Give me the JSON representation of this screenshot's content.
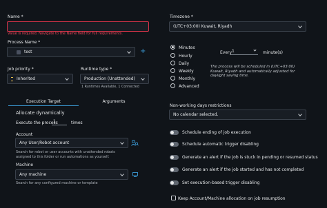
{
  "left": {
    "name": {
      "label": "Name *",
      "value": "",
      "error": "Value is required. Navigate to the Name field for full requirements."
    },
    "process": {
      "label": "Process Name *",
      "value": "test",
      "add_icon": "plus-icon"
    },
    "job_priority": {
      "label": "Job priority *",
      "value": "Inherited"
    },
    "runtime_type": {
      "label": "Runtime type *",
      "value": "Production (Unattended)",
      "info": "1 Runtimes Available, 1 Connected"
    },
    "tabs": [
      {
        "label": "Execution Target",
        "active": true
      },
      {
        "label": "Arguments",
        "active": false
      }
    ],
    "allocate_title": "Allocate dynamically",
    "execute_prefix": "Execute the process",
    "execute_value": "1",
    "execute_suffix": "times",
    "account": {
      "label": "Account",
      "value": "Any User/Robot account",
      "help": "Search for robot or user accounts with unattended robots assigned to this folder or run automations as yourself."
    },
    "machine": {
      "label": "Machine",
      "value": "Any machine",
      "help": "Search for any configured machine or template"
    }
  },
  "right": {
    "timezone": {
      "label": "Timezone *",
      "value": "(UTC+03:00) Kuwait, Riyadh"
    },
    "frequency_options": [
      {
        "label": "Minutes",
        "selected": true
      },
      {
        "label": "Hourly",
        "selected": false
      },
      {
        "label": "Daily",
        "selected": false
      },
      {
        "label": "Weekly",
        "selected": false
      },
      {
        "label": "Monthly",
        "selected": false
      },
      {
        "label": "Advanced",
        "selected": false
      }
    ],
    "every_prefix": "Every",
    "every_value": "1",
    "every_suffix": "minute(s)",
    "schedule_note": "The process will be scheduled in (UTC+03:00) Kuwait, Riyadh and automatically adjusted for daylight saving time.",
    "non_working": {
      "label": "Non-working days restrictions",
      "value": "No calendar selected."
    },
    "toggles": [
      {
        "label": "Schedule ending of job execution"
      },
      {
        "label": "Schedule automatic trigger disabling"
      },
      {
        "label": "Generate an alert if the job is stuck in pending or resumed status"
      },
      {
        "label": "Generate an alert if the job started and has not completed"
      },
      {
        "label": "Set execution-based trigger disabling"
      }
    ],
    "keep_account": {
      "label": "Keep Account/Machine allocation on job resumption"
    }
  },
  "colors": {
    "background": "#101419",
    "error": "#d9344a",
    "accent": "#3b9bd6",
    "field_bg": "#181d24"
  }
}
